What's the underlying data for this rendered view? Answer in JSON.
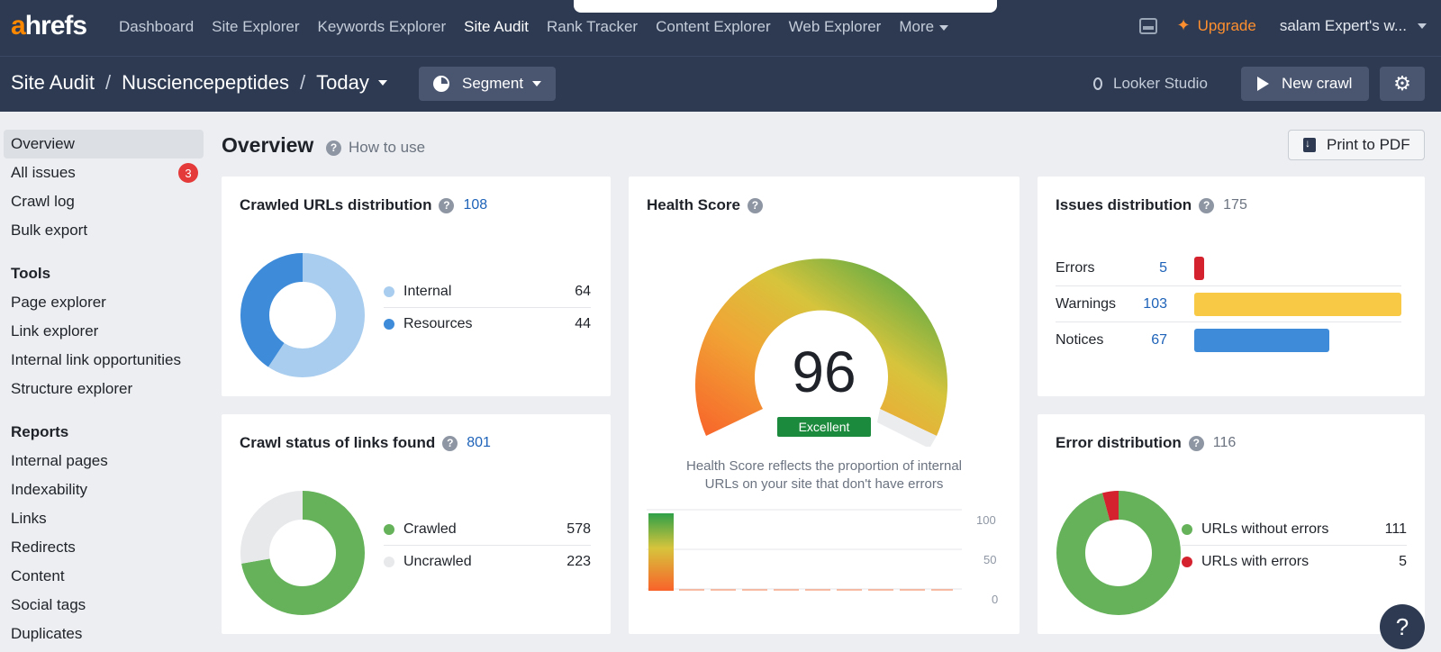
{
  "nav": {
    "logo_a": "a",
    "logo_rest": "hrefs",
    "items": [
      {
        "label": "Dashboard"
      },
      {
        "label": "Site Explorer"
      },
      {
        "label": "Keywords Explorer"
      },
      {
        "label": "Site Audit"
      },
      {
        "label": "Rank Tracker"
      },
      {
        "label": "Content Explorer"
      },
      {
        "label": "Web Explorer"
      },
      {
        "label": "More"
      }
    ],
    "upgrade": "Upgrade",
    "account": "salam Expert's w..."
  },
  "subheader": {
    "crumb1": "Site Audit",
    "crumb2": "Nusciencepeptides",
    "crumb3": "Today",
    "separator": "/",
    "segment": "Segment",
    "looker": "Looker Studio",
    "new_crawl": "New crawl"
  },
  "sidebar": {
    "items1": [
      "Overview",
      "All issues",
      "Crawl log",
      "Bulk export"
    ],
    "all_issues_badge": "3",
    "tools_heading": "Tools",
    "tools": [
      "Page explorer",
      "Link explorer",
      "Internal link opportunities",
      "Structure explorer"
    ],
    "reports_heading": "Reports",
    "reports": [
      "Internal pages",
      "Indexability",
      "Links",
      "Redirects",
      "Content",
      "Social tags",
      "Duplicates"
    ]
  },
  "main": {
    "title": "Overview",
    "how_to_use": "How to use",
    "print": "Print to PDF",
    "help_glyph": "?"
  },
  "crawled": {
    "title": "Crawled URLs distribution",
    "total": "108",
    "rows": [
      {
        "label": "Internal",
        "value": "64",
        "color": "#a9cdee"
      },
      {
        "label": "Resources",
        "value": "44",
        "color": "#3d8bd9"
      }
    ]
  },
  "crawl_status": {
    "title": "Crawl status of links found",
    "total": "801",
    "rows": [
      {
        "label": "Crawled",
        "value": "578",
        "color": "#65b25a"
      },
      {
        "label": "Uncrawled",
        "value": "223",
        "color": "#e8e9eb"
      }
    ]
  },
  "health": {
    "title": "Health Score",
    "score": "96",
    "rating": "Excellent",
    "desc1": "Health Score reflects the proportion of internal",
    "desc2": "URLs on your site that don't have errors",
    "axis": [
      "100",
      "50",
      "0"
    ]
  },
  "issues": {
    "title": "Issues distribution",
    "total": "175",
    "rows": [
      {
        "label": "Errors",
        "value": "5",
        "color": "#d4222f"
      },
      {
        "label": "Warnings",
        "value": "103",
        "color": "#f8c944"
      },
      {
        "label": "Notices",
        "value": "67",
        "color": "#3d8bd9"
      }
    ]
  },
  "errors": {
    "title": "Error distribution",
    "total": "116",
    "rows": [
      {
        "label": "URLs without errors",
        "value": "111",
        "color": "#65b25a"
      },
      {
        "label": "URLs with errors",
        "value": "5",
        "color": "#d4222f"
      }
    ]
  },
  "help_fab": "?"
}
